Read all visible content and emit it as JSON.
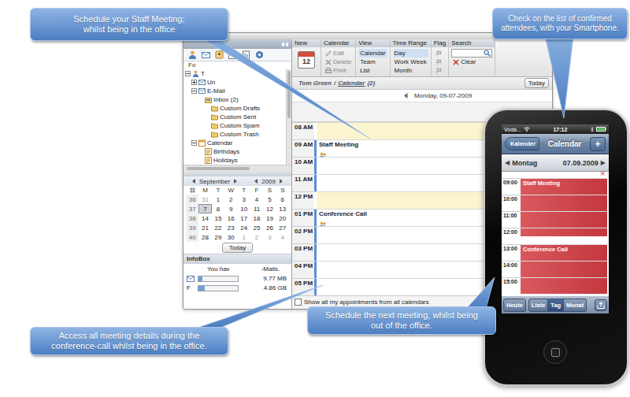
{
  "callouts": [
    {
      "lines": [
        "Schedule your Staff Meeting;",
        "whilst being in the office"
      ]
    },
    {
      "lines": [
        "Check on the list of confirmed",
        "attendees, with your Smartphone."
      ]
    },
    {
      "lines": [
        "Access all meeting details during the",
        "conference-call whilst being in the office."
      ]
    },
    {
      "lines": [
        "Schedule the next meeting, whilst being",
        "out of the office."
      ]
    }
  ],
  "desktop": {
    "sidebar": {
      "tree_title": "Fo",
      "folders": [
        {
          "label": "T",
          "kind": "user",
          "depth": 0,
          "expandable": true,
          "expanded": true
        },
        {
          "label": "Un",
          "kind": "mailbox",
          "depth": 1,
          "expandable": true,
          "expanded": false
        },
        {
          "label": "E-Mail",
          "kind": "mailbox",
          "depth": 1,
          "expandable": true,
          "expanded": true
        },
        {
          "label": "Inbox (2)",
          "kind": "inbox",
          "depth": 2,
          "expandable": false,
          "expanded": false
        },
        {
          "label": "Custom Drafts",
          "kind": "folder",
          "depth": 3,
          "expandable": false,
          "expanded": false
        },
        {
          "label": "Custom Sent",
          "kind": "folder",
          "depth": 3,
          "expandable": false,
          "expanded": false
        },
        {
          "label": "Custom Spam",
          "kind": "folder",
          "depth": 3,
          "expandable": false,
          "expanded": false
        },
        {
          "label": "Custom Trash",
          "kind": "folder",
          "depth": 3,
          "expandable": false,
          "expanded": false
        },
        {
          "label": "Calendar",
          "kind": "calendar",
          "depth": 1,
          "expandable": true,
          "expanded": true
        },
        {
          "label": "Birthdays",
          "kind": "calendar-item",
          "depth": 2,
          "expandable": false,
          "expanded": false
        },
        {
          "label": "Holidays",
          "kind": "calendar-item",
          "depth": 2,
          "expandable": false,
          "expanded": false
        }
      ]
    },
    "mini_calendar": {
      "month": "September",
      "year": "2009",
      "weekdays": [
        "M",
        "T",
        "W",
        "T",
        "F",
        "S",
        "S"
      ],
      "weeks": [
        {
          "number": "36",
          "days": [
            {
              "day": "31",
              "muted": true,
              "selected": false
            },
            {
              "day": "1",
              "muted": false,
              "selected": false
            },
            {
              "day": "2",
              "muted": false,
              "selected": false
            },
            {
              "day": "3",
              "muted": false,
              "selected": false
            },
            {
              "day": "4",
              "muted": false,
              "selected": false
            },
            {
              "day": "5",
              "muted": false,
              "selected": false
            },
            {
              "day": "6",
              "muted": false,
              "selected": false
            }
          ]
        },
        {
          "number": "37",
          "days": [
            {
              "day": "7",
              "muted": false,
              "selected": true
            },
            {
              "day": "8",
              "muted": false,
              "selected": false
            },
            {
              "day": "9",
              "muted": false,
              "selected": false
            },
            {
              "day": "10",
              "muted": false,
              "selected": false
            },
            {
              "day": "11",
              "muted": false,
              "selected": false
            },
            {
              "day": "12",
              "muted": false,
              "selected": false
            },
            {
              "day": "13",
              "muted": false,
              "selected": false
            }
          ]
        },
        {
          "number": "38",
          "days": [
            {
              "day": "14",
              "muted": false,
              "selected": false
            },
            {
              "day": "15",
              "muted": false,
              "selected": false
            },
            {
              "day": "16",
              "muted": false,
              "selected": false
            },
            {
              "day": "17",
              "muted": false,
              "selected": false
            },
            {
              "day": "18",
              "muted": false,
              "selected": false
            },
            {
              "day": "19",
              "muted": false,
              "selected": false
            },
            {
              "day": "20",
              "muted": false,
              "selected": false
            }
          ]
        },
        {
          "number": "39",
          "days": [
            {
              "day": "21",
              "muted": false,
              "selected": false
            },
            {
              "day": "22",
              "muted": false,
              "selected": false
            },
            {
              "day": "23",
              "muted": false,
              "selected": false
            },
            {
              "day": "24",
              "muted": false,
              "selected": false
            },
            {
              "day": "25",
              "muted": false,
              "selected": false
            },
            {
              "day": "26",
              "muted": false,
              "selected": false
            },
            {
              "day": "27",
              "muted": false,
              "selected": false
            }
          ]
        },
        {
          "number": "40",
          "days": [
            {
              "day": "28",
              "muted": false,
              "selected": false
            },
            {
              "day": "29",
              "muted": false,
              "selected": false
            },
            {
              "day": "30",
              "muted": false,
              "selected": false
            },
            {
              "day": "1",
              "muted": true,
              "selected": false
            },
            {
              "day": "2",
              "muted": true,
              "selected": false
            },
            {
              "day": "3",
              "muted": true,
              "selected": false
            },
            {
              "day": "4",
              "muted": true,
              "selected": false
            }
          ]
        }
      ]
    },
    "today_button": "Today",
    "infobox": {
      "title": "InfoBox",
      "message_start": "You hav",
      "message_end": "-Mails.",
      "quotas": [
        {
          "reading": "9.77 MB",
          "level": 0.1
        },
        {
          "label": "F",
          "reading": "4.86 GB",
          "level": 0.15
        }
      ]
    },
    "toolbar": [
      {
        "title": "New",
        "kind": "new",
        "icon_text": "12"
      },
      {
        "title": "Calendar",
        "kind": "actions",
        "items": [
          {
            "label": "Edit",
            "disabled": true
          },
          {
            "label": "Delete",
            "disabled": true
          },
          {
            "label": "Print",
            "disabled": true
          }
        ]
      },
      {
        "title": "View",
        "kind": "options",
        "items": [
          {
            "label": "Calendar",
            "selected": true
          },
          {
            "label": "Team",
            "selected": false
          },
          {
            "label": "List",
            "selected": false
          }
        ]
      },
      {
        "title": "Time Range",
        "kind": "options",
        "items": [
          {
            "label": "Day",
            "selected": true
          },
          {
            "label": "Work Week",
            "selected": false
          },
          {
            "label": "Month",
            "selected": false
          }
        ]
      },
      {
        "title": "Flag",
        "kind": "flags",
        "items": [
          {
            "disabled": true
          },
          {
            "disabled": true
          },
          {
            "disabled": true
          }
        ]
      },
      {
        "title": "Search",
        "kind": "search",
        "clear": "Clear"
      }
    ],
    "calendar": {
      "owner": "Tom Green",
      "separator": "/",
      "folder": "Calendar",
      "count": "(2)",
      "today_button": "Today",
      "date": "Monday, 09-07-2009",
      "hours": [
        {
          "label": "08 AM",
          "highlight": true,
          "busy": false
        },
        {
          "label": "09 AM",
          "highlight": false,
          "busy": true,
          "event": "Staff Meeting"
        },
        {
          "label": "10 AM",
          "highlight": false,
          "busy": true
        },
        {
          "label": "11 AM",
          "highlight": false,
          "busy": true
        },
        {
          "label": "12 PM",
          "highlight": true,
          "busy": false
        },
        {
          "label": "01 PM",
          "highlight": false,
          "busy": true,
          "event": "Conference Call"
        },
        {
          "label": "02 PM",
          "highlight": false,
          "busy": true
        },
        {
          "label": "03 PM",
          "highlight": false,
          "busy": true
        },
        {
          "label": "04 PM",
          "highlight": false,
          "busy": true
        },
        {
          "label": "05 PM",
          "highlight": false,
          "busy": true
        }
      ],
      "show_all": {
        "label": "Show all my appointments from all calendars",
        "checked": false
      }
    }
  },
  "phone": {
    "carrier": "Voda...",
    "time": "17:12",
    "back": "Kalender",
    "title": "Calendar",
    "add": "+",
    "prev": "◀",
    "day": "Montag",
    "date": "07.09.2009",
    "next": "▶",
    "close": "×",
    "hours": [
      {
        "time": "09:00",
        "level": 1,
        "event": "Staff Meeting"
      },
      {
        "time": "10:00",
        "level": 1
      },
      {
        "time": "11:00",
        "level": 1
      },
      {
        "time": "12:00",
        "level": 0.5
      },
      {
        "time": "13:00",
        "level": 1,
        "event": "Conference Call"
      },
      {
        "time": "14:00",
        "level": 1
      },
      {
        "time": "15:00",
        "level": 1
      }
    ],
    "toolbar": [
      {
        "label": "Heute",
        "kind": "button",
        "selected": false
      },
      {
        "label": "Liste",
        "kind": "segment",
        "selected": false
      },
      {
        "label": "Tag",
        "kind": "segment",
        "selected": true
      },
      {
        "label": "Monat",
        "kind": "segment",
        "selected": false
      }
    ]
  }
}
